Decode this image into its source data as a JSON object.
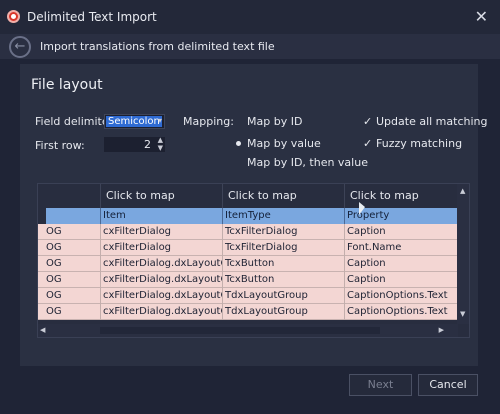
{
  "window": {
    "title": "Delimited Text Import",
    "close_glyph": "✕"
  },
  "subheader": {
    "back_glyph": "←",
    "text": "Import translations from delimited text file"
  },
  "section": {
    "title": "File layout"
  },
  "field_delimiter": {
    "label": "Field delimiter:",
    "value": "Semicolon",
    "arrow": "▾"
  },
  "first_row": {
    "label": "First row:",
    "value": "2",
    "arrows": "▲\n▼"
  },
  "mapping": {
    "label": "Mapping:",
    "options": [
      {
        "label": "Map by ID",
        "selected": false
      },
      {
        "label": "Map by value",
        "selected": true
      },
      {
        "label": "Map by ID, then value",
        "selected": false
      }
    ]
  },
  "checks": [
    {
      "mark": "✓",
      "label": "Update all matching",
      "checked": true
    },
    {
      "mark": "✓",
      "label": "Fuzzy matching",
      "checked": true
    }
  ],
  "grid": {
    "map_label": "Click to map",
    "columns": [
      "Item",
      "ItemType",
      "Property"
    ],
    "rows": [
      [
        "OG",
        "cxFilterDialog",
        "TcxFilterDialog",
        "Caption"
      ],
      [
        "OG",
        "cxFilterDialog",
        "TcxFilterDialog",
        "Font.Name"
      ],
      [
        "OG",
        "cxFilterDialog.dxLayoutC...",
        "TcxButton",
        "Caption"
      ],
      [
        "OG",
        "cxFilterDialog.dxLayoutC...",
        "TcxButton",
        "Caption"
      ],
      [
        "OG",
        "cxFilterDialog.dxLayoutC...",
        "TdxLayoutGroup",
        "CaptionOptions.Text"
      ],
      [
        "OG",
        "cxFilterDialog.dxLayoutC...",
        "TdxLayoutGroup",
        "CaptionOptions.Text"
      ]
    ],
    "scroll_up": "▲",
    "scroll_down": "▼",
    "scroll_left": "◀",
    "scroll_right": "▶"
  },
  "buttons": {
    "next": "Next",
    "cancel": "Cancel"
  },
  "colors": {
    "accent": "#2f6bd3",
    "row_bg": "#f3d6d3",
    "property_row": "#7aa7df",
    "app_icon": "#d9362b"
  }
}
